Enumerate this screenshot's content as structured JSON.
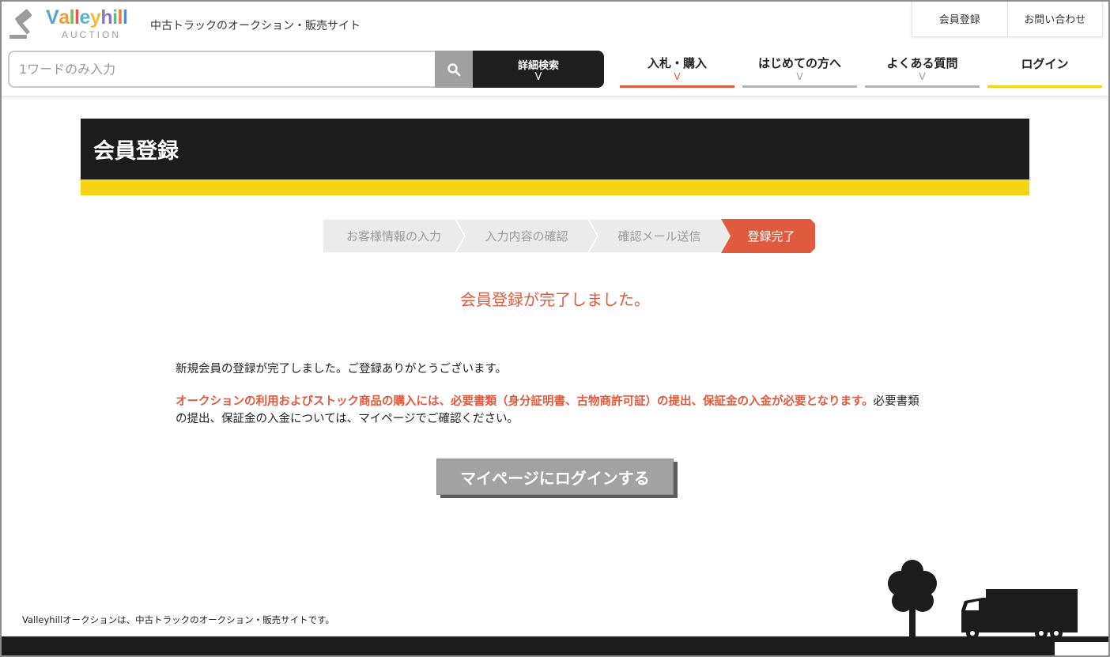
{
  "header": {
    "logo_letters": [
      "V",
      "a",
      "l",
      "l",
      "e",
      "y",
      "h",
      "i",
      "l",
      "l"
    ],
    "logo_colors": [
      "#5aa0d8",
      "#e8a23a",
      "#6fc05a",
      "#e4565a",
      "#57b5c8",
      "#f0bc3a",
      "#8a76c4",
      "#5fba86",
      "#e77a3c",
      "#4d8fd6"
    ],
    "logo_sub": "AUCTION",
    "tagline": "中古トラックのオークション・販売サイト",
    "top_links": [
      "会員登録",
      "お問い合わせ"
    ],
    "search_placeholder": "1ワードのみ入力",
    "search_icon": "search-icon",
    "advanced_search": "詳細検索",
    "chevron": "V",
    "nav": [
      {
        "label": "入札・購入",
        "bar_color": "#e05a3d",
        "chevron_color": "#e05a3d",
        "has_chevron": true
      },
      {
        "label": "はじめての方へ",
        "bar_color": "#b4b4b4",
        "chevron_color": "#9a9a9a",
        "has_chevron": true
      },
      {
        "label": "よくある質問",
        "bar_color": "#b4b4b4",
        "chevron_color": "#9a9a9a",
        "has_chevron": true
      },
      {
        "label": "ログイン",
        "bar_color": "#f7d316",
        "chevron_color": "#9a9a9a",
        "has_chevron": false
      }
    ]
  },
  "page": {
    "title": "会員登録",
    "steps": [
      {
        "label": "お客様情報の入力",
        "active": false
      },
      {
        "label": "入力内容の確認",
        "active": false
      },
      {
        "label": "確認メール送信",
        "active": false
      },
      {
        "label": "登録完了",
        "active": true
      }
    ],
    "step_colors": {
      "inactive": "#ebebeb",
      "active": "#e05a3d"
    },
    "complete_message": "会員登録が完了しました。",
    "thanks": "新規会員の登録が完了しました。ご登録ありがとうございます。",
    "warning": "オークションの利用およびストック商品の購入には、必要書類（身分証明書、古物商許可証）の提出、保証金の入金が必要となります。",
    "followup": "必要書類の提出、保証金の入金については、マイページでご確認ください。",
    "login_button": "マイページにログインする"
  },
  "footer": {
    "text": "Valleyhillオークションは、中古トラックのオークション・販売サイトです。",
    "illustration": "tree-and-truck-silhouette"
  },
  "colors": {
    "accent": "#e05a3d",
    "yellow": "#f7d316",
    "dark": "#1c1c1c"
  }
}
